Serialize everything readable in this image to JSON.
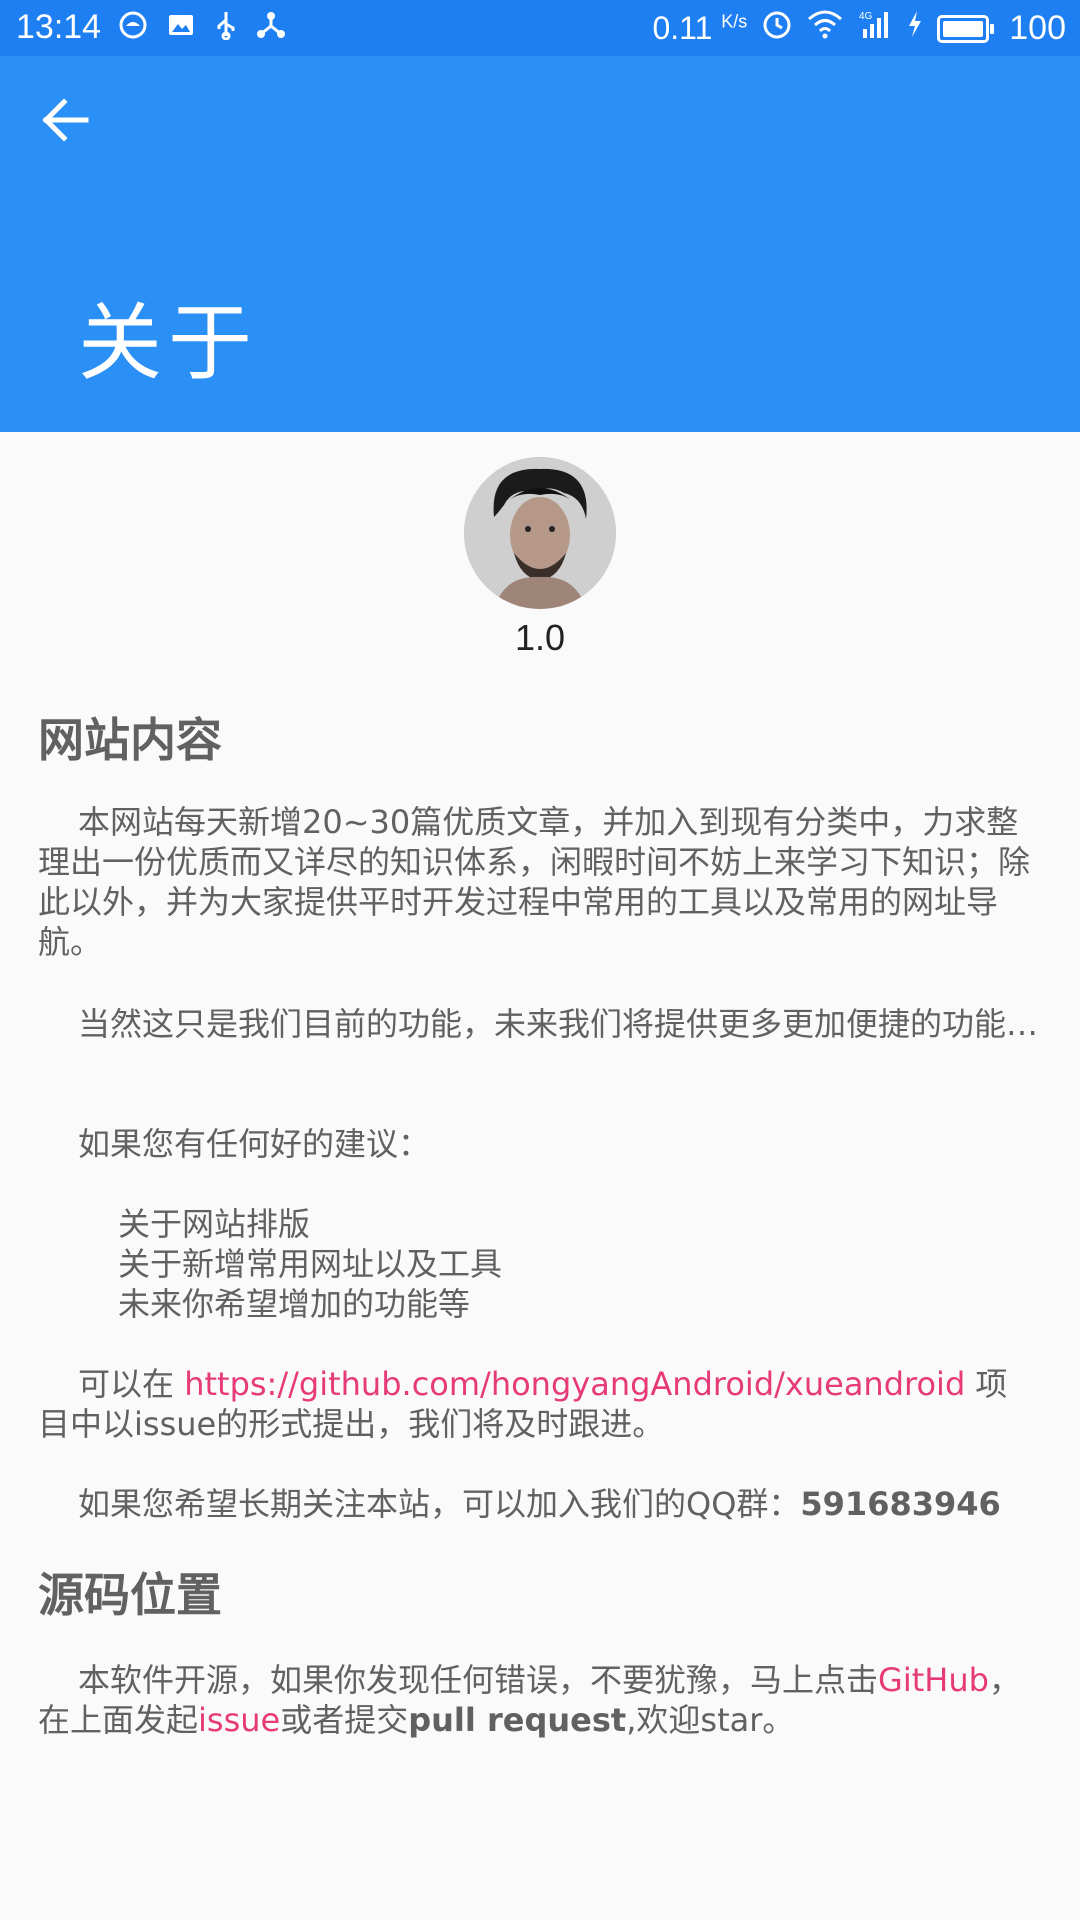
{
  "status_bar": {
    "time": "13:14",
    "speed": "0.11",
    "speed_unit": "K/s",
    "network": "4G",
    "battery": "100",
    "battery_level": 1.0
  },
  "app_bar": {
    "title": "关于",
    "back_icon": "arrow-left-icon"
  },
  "header": {
    "version": "1.0"
  },
  "section1": {
    "title": "网站内容",
    "para1": "本网站每天新增20~30篇优质文章，并加入到现有分类中，力求整理出一份优质而又详尽的知识体系，闲暇时间不妨上来学习下知识；除此以外，并为大家提供平时开发过程中常用的工具以及常用的网址导航。",
    "para2": "当然这只是我们目前的功能，未来我们将提供更多更加便捷的功能…",
    "para3": "如果您有任何好的建议：",
    "list": [
      "关于网站排版",
      "关于新增常用网址以及工具",
      "未来你希望增加的功能等"
    ],
    "para4_prefix": "可以在 ",
    "para4_link": "https://github.com/hongyangAndroid/xueandroid",
    "para4_suffix": " 项目中以issue的形式提出，我们将及时跟进。",
    "para5_prefix": "如果您希望长期关注本站，可以加入我们的QQ群：",
    "qq_number": "591683946"
  },
  "section2": {
    "title": "源码位置",
    "text_prefix": "本软件开源，如果你发现任何错误，不要犹豫，马上点击",
    "github_link": "GitHub",
    "text_mid": "，在上面发起",
    "issue_link": "issue",
    "text_mid2": "或者提交",
    "pull_request": "pull request",
    "text_suffix": ",欢迎star。"
  },
  "colors": {
    "status_bar": "#1e7ff3",
    "app_bar": "#2a90f6",
    "link": "#e63b78",
    "text": "#616161"
  }
}
